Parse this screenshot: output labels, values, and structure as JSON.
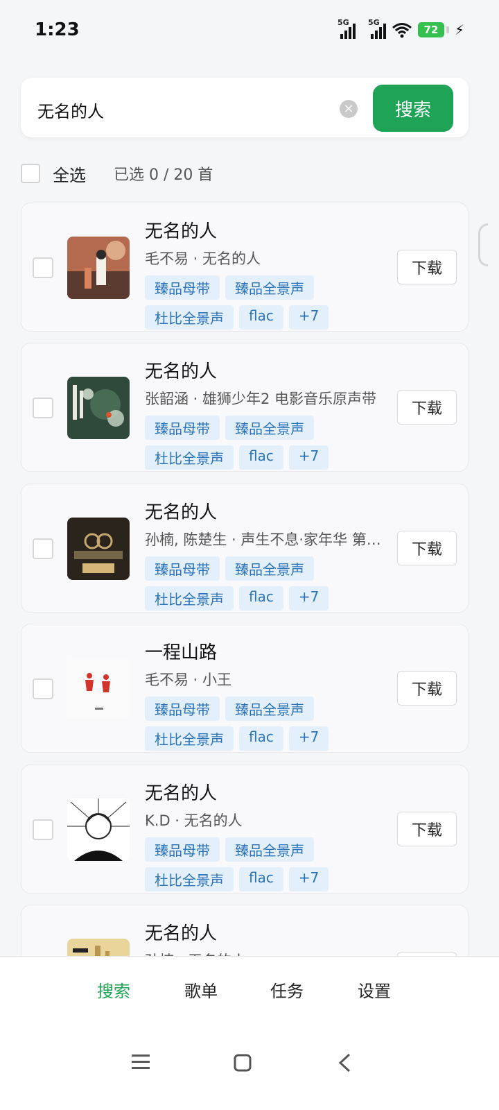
{
  "status_bar": {
    "time": "1:23",
    "network_1": "5G",
    "network_2": "5G",
    "battery": "72",
    "icons": [
      "signal-icon",
      "signal-icon",
      "wifi-icon",
      "battery-icon",
      "charging-icon"
    ]
  },
  "search": {
    "query": "无名的人",
    "button_label": "搜索",
    "clear_icon": "clear-icon"
  },
  "selection": {
    "select_all_label": "全选",
    "selected_count": "已选 0 / 20 首"
  },
  "songs": [
    {
      "title": "无名的人",
      "subtitle": "毛不易 · 无名的人",
      "tags": [
        "臻品母带",
        "臻品全景声",
        "杜比全景声",
        "flac",
        "+7"
      ],
      "download_label": "下载"
    },
    {
      "title": "无名的人",
      "subtitle": "张韶涵 · 雄狮少年2 电影音乐原声带",
      "tags": [
        "臻品母带",
        "臻品全景声",
        "杜比全景声",
        "flac",
        "+7"
      ],
      "download_label": "下载"
    },
    {
      "title": "无名的人",
      "subtitle": "孙楠, 陈楚生 · 声生不息·家年华 第3期",
      "tags": [
        "臻品母带",
        "臻品全景声",
        "杜比全景声",
        "flac",
        "+7"
      ],
      "download_label": "下载"
    },
    {
      "title": "一程山路",
      "subtitle": "毛不易 · 小王",
      "tags": [
        "臻品母带",
        "臻品全景声",
        "杜比全景声",
        "flac",
        "+7"
      ],
      "download_label": "下载"
    },
    {
      "title": "无名的人",
      "subtitle": "K.D · 无名的人",
      "tags": [
        "臻品母带",
        "臻品全景声",
        "杜比全景声",
        "flac",
        "+7"
      ],
      "download_label": "下载"
    },
    {
      "title": "无名的人",
      "subtitle": "孙楠 · 无名的人",
      "tags": [],
      "download_label": "下载"
    }
  ],
  "tabs": [
    {
      "label": "搜索",
      "active": true
    },
    {
      "label": "歌单",
      "active": false
    },
    {
      "label": "任务",
      "active": false
    },
    {
      "label": "设置",
      "active": false
    }
  ],
  "nav": {
    "menu": "menu-icon",
    "home": "home-icon",
    "back": "back-icon"
  },
  "colors": {
    "accent": "#1fa356",
    "tag_bg": "#e3effa",
    "tag_text": "#2b73b8"
  }
}
